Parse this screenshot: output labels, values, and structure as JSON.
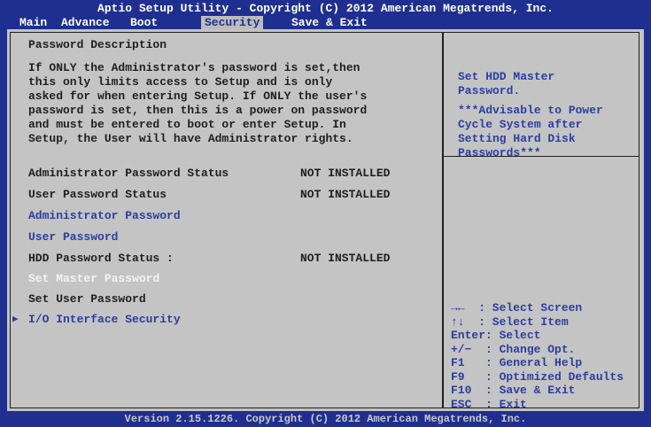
{
  "title": "Aptio Setup Utility - Copyright (C) 2012 American Megatrends, Inc.",
  "tabs": [
    "Main",
    "Advance",
    "Boot",
    "Security",
    "Save & Exit"
  ],
  "active_tab": "Security",
  "heading": "Password Description",
  "description": "If ONLY the Administrator's password is set,then\nthis only limits access to Setup and is only\nasked for when entering Setup. If ONLY the user's\npassword is set, then this is a power on password\nand must be entered to boot or enter Setup. In\nSetup, the User will have Administrator rights.",
  "items": [
    {
      "label": "Administrator Password Status",
      "value": "NOT INSTALLED"
    },
    {
      "label": "User Password Status",
      "value": "NOT INSTALLED"
    },
    {
      "label": "Administrator Password"
    },
    {
      "label": "User Password"
    },
    {
      "label": "HDD Password Status :",
      "value": "NOT INSTALLED"
    },
    {
      "label": "Set Master Password"
    },
    {
      "label": "Set User Password"
    },
    {
      "label": "I/O Interface Security"
    }
  ],
  "help": {
    "line1": "Set HDD Master\nPassword.",
    "line2": "***Advisable to Power\nCycle System after\nSetting Hard Disk\nPasswords***"
  },
  "keys": [
    "→←  : Select Screen",
    "↑↓  : Select Item",
    "Enter: Select",
    "+/−  : Change Opt.",
    "F1   : General Help",
    "F9   : Optimized Defaults",
    "F10  : Save & Exit",
    "ESC  : Exit"
  ],
  "footer": "Version 2.15.1226. Copyright (C) 2012 American Megatrends, Inc."
}
